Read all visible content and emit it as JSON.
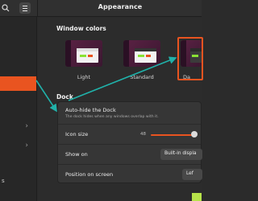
{
  "header": {
    "title": "Appearance",
    "menu_icon": "hamburger-menu-icon",
    "search_icon": "search-icon"
  },
  "sidebar": {
    "partial_text": "s",
    "selected_index": 3
  },
  "window_colors": {
    "title": "Window colors",
    "options": [
      {
        "label": "Light"
      },
      {
        "label": "Standard"
      },
      {
        "label": "Da"
      }
    ],
    "selected": "Dark"
  },
  "dock": {
    "title": "Dock",
    "autohide": {
      "label": "Auto-hide the Dock",
      "description": "The dock hides when any windows overlap with it."
    },
    "icon_size": {
      "label": "Icon size",
      "value": "48"
    },
    "show_on": {
      "label": "Show on",
      "value": "Built-in displa"
    },
    "position": {
      "label": "Position on screen",
      "value": "Lef"
    }
  },
  "colors": {
    "accent": "#e95420",
    "annotation_arrow": "#20b2aa",
    "lime": "#8ae234"
  }
}
